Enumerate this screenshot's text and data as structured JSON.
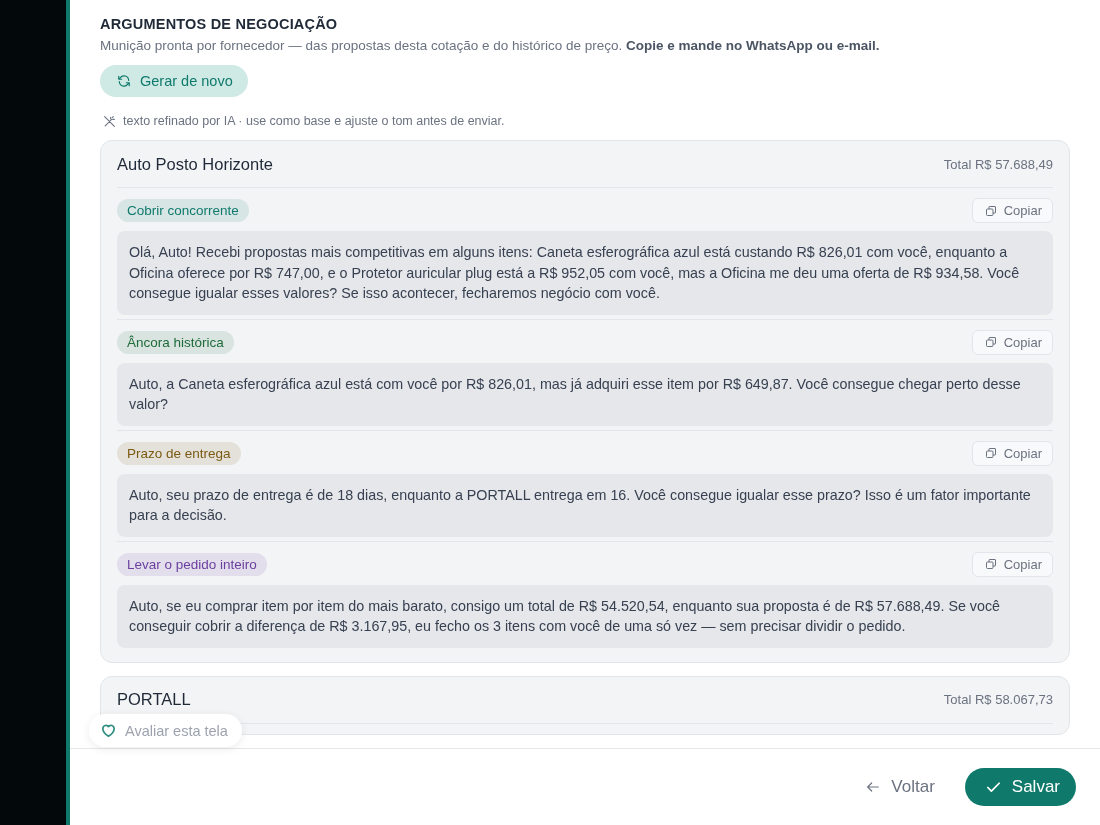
{
  "section": {
    "title": "ARGUMENTOS DE NEGOCIAÇÃO",
    "description": "Munição pronta por fornecedor — das propostas desta cotação e do histórico de preço. **Copie e mande no WhatsApp ou e-mail.**",
    "regenerate_button": "Gerar de novo",
    "ai_note": "texto refinado por IA · use como base e ajuste o tom antes de enviar."
  },
  "suppliers": [
    {
      "name": "Auto Posto Horizonte",
      "total": "Total R$ 57.688,49",
      "arguments": [
        {
          "tag": "Cobrir concorrente",
          "color": "#0f7a6c",
          "copy": "Copiar",
          "message": "Olá, Auto! Recebi propostas mais competitivas em alguns itens: Caneta esferográfica azul está custando R$ 826,01 com você, enquanto a Oficina oferece por R$ 747,00, e o Protetor auricular plug está a R$ 952,05 com você, mas a Oficina me deu uma oferta de R$ 934,58. Você consegue igualar esses valores? Se isso acontecer, fecharemos negócio com você."
        },
        {
          "tag": "Âncora histórica",
          "color": "#1f6b3a",
          "copy": "Copiar",
          "message": "Auto, a Caneta esferográfica azul está com você por R$ 826,01, mas já adquiri esse item por R$ 649,87. Você consegue chegar perto desse valor?"
        },
        {
          "tag": "Prazo de entrega",
          "color": "#7a5a12",
          "copy": "Copiar",
          "message": "Auto, seu prazo de entrega é de 18 dias, enquanto a PORTALL entrega em 16. Você consegue igualar esse prazo? Isso é um fator importante para a decisão."
        },
        {
          "tag": "Levar o pedido inteiro",
          "color": "#6b3fa0",
          "copy": "Copiar",
          "message": "Auto, se eu comprar item por item do mais barato, consigo um total de R$ 54.520,54, enquanto sua proposta é de R$ 57.688,49. Se você conseguir cobrir a diferença de R$ 3.167,95, eu fecho os 3 itens com você de uma só vez — sem precisar dividir o pedido."
        }
      ]
    },
    {
      "name": "PORTALL",
      "total": "Total R$ 58.067,73"
    }
  ],
  "feedback_button": "Avaliar esta tela",
  "footer": {
    "back_button": "Voltar",
    "save_button": "Salvar"
  }
}
